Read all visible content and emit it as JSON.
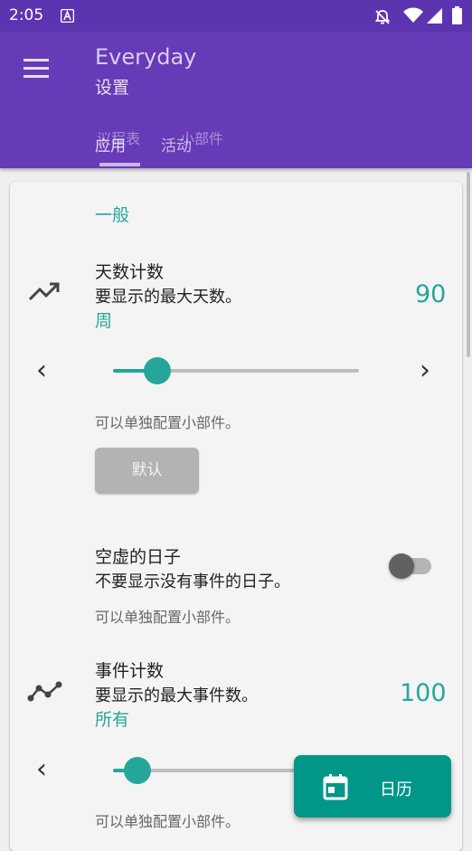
{
  "status_bar": {
    "time": "2:05"
  },
  "app_bar": {
    "title": "Everyday",
    "subtitle": "设置",
    "tabs": [
      {
        "label": "应用"
      },
      {
        "label": "议程表"
      },
      {
        "label": "活动"
      },
      {
        "label": "小部件"
      }
    ]
  },
  "settings": {
    "section_general": "一般",
    "day_count": {
      "title": "天数计数",
      "summary": "要显示的最大天数。",
      "unit": "周",
      "value": "90",
      "slider_fraction": 0.18,
      "note": "可以单独配置小部件。",
      "default_button": "默认"
    },
    "empty_days": {
      "title": "空虚的日子",
      "summary": "不要显示没有事件的日子。",
      "note": "可以单独配置小部件。",
      "enabled": false
    },
    "event_count": {
      "title": "事件计数",
      "summary": "要显示的最大事件数。",
      "unit": "所有",
      "value": "100",
      "slider_fraction": 0.1,
      "note": "可以单独配置小部件。"
    }
  },
  "fab": {
    "label": "日历",
    "icon": "calendar-icon"
  },
  "colors": {
    "primary": "#673ab7",
    "status_bar": "#5d34b0",
    "accent": "#26a69a",
    "fab": "#009688"
  }
}
